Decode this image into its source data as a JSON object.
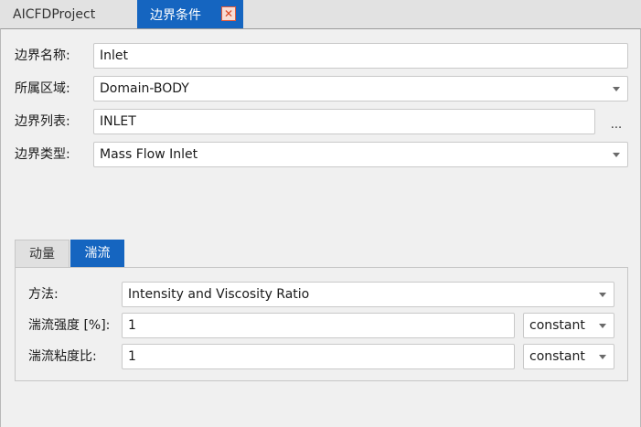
{
  "tabs": {
    "project_label": "AICFDProject",
    "boundary_label": "边界条件",
    "close_glyph": "✕"
  },
  "form": {
    "name_label": "边界名称:",
    "name_value": "Inlet",
    "region_label": "所属区域:",
    "region_value": "Domain-BODY",
    "list_label": "边界列表:",
    "list_value": "INLET",
    "browse_label": "...",
    "type_label": "边界类型:",
    "type_value": "Mass Flow Inlet"
  },
  "subtabs": {
    "momentum_label": "动量",
    "turbulence_label": "湍流"
  },
  "turbulence": {
    "method_label": "方法:",
    "method_value": "Intensity and Viscosity Ratio",
    "intensity_label": "湍流强度 [%]:",
    "intensity_value": "1",
    "intensity_mode": "constant",
    "viscosity_label": "湍流粘度比:",
    "viscosity_value": "1",
    "viscosity_mode": "constant"
  },
  "colors": {
    "accent": "#1565c0",
    "close_icon": "#d9431f"
  }
}
